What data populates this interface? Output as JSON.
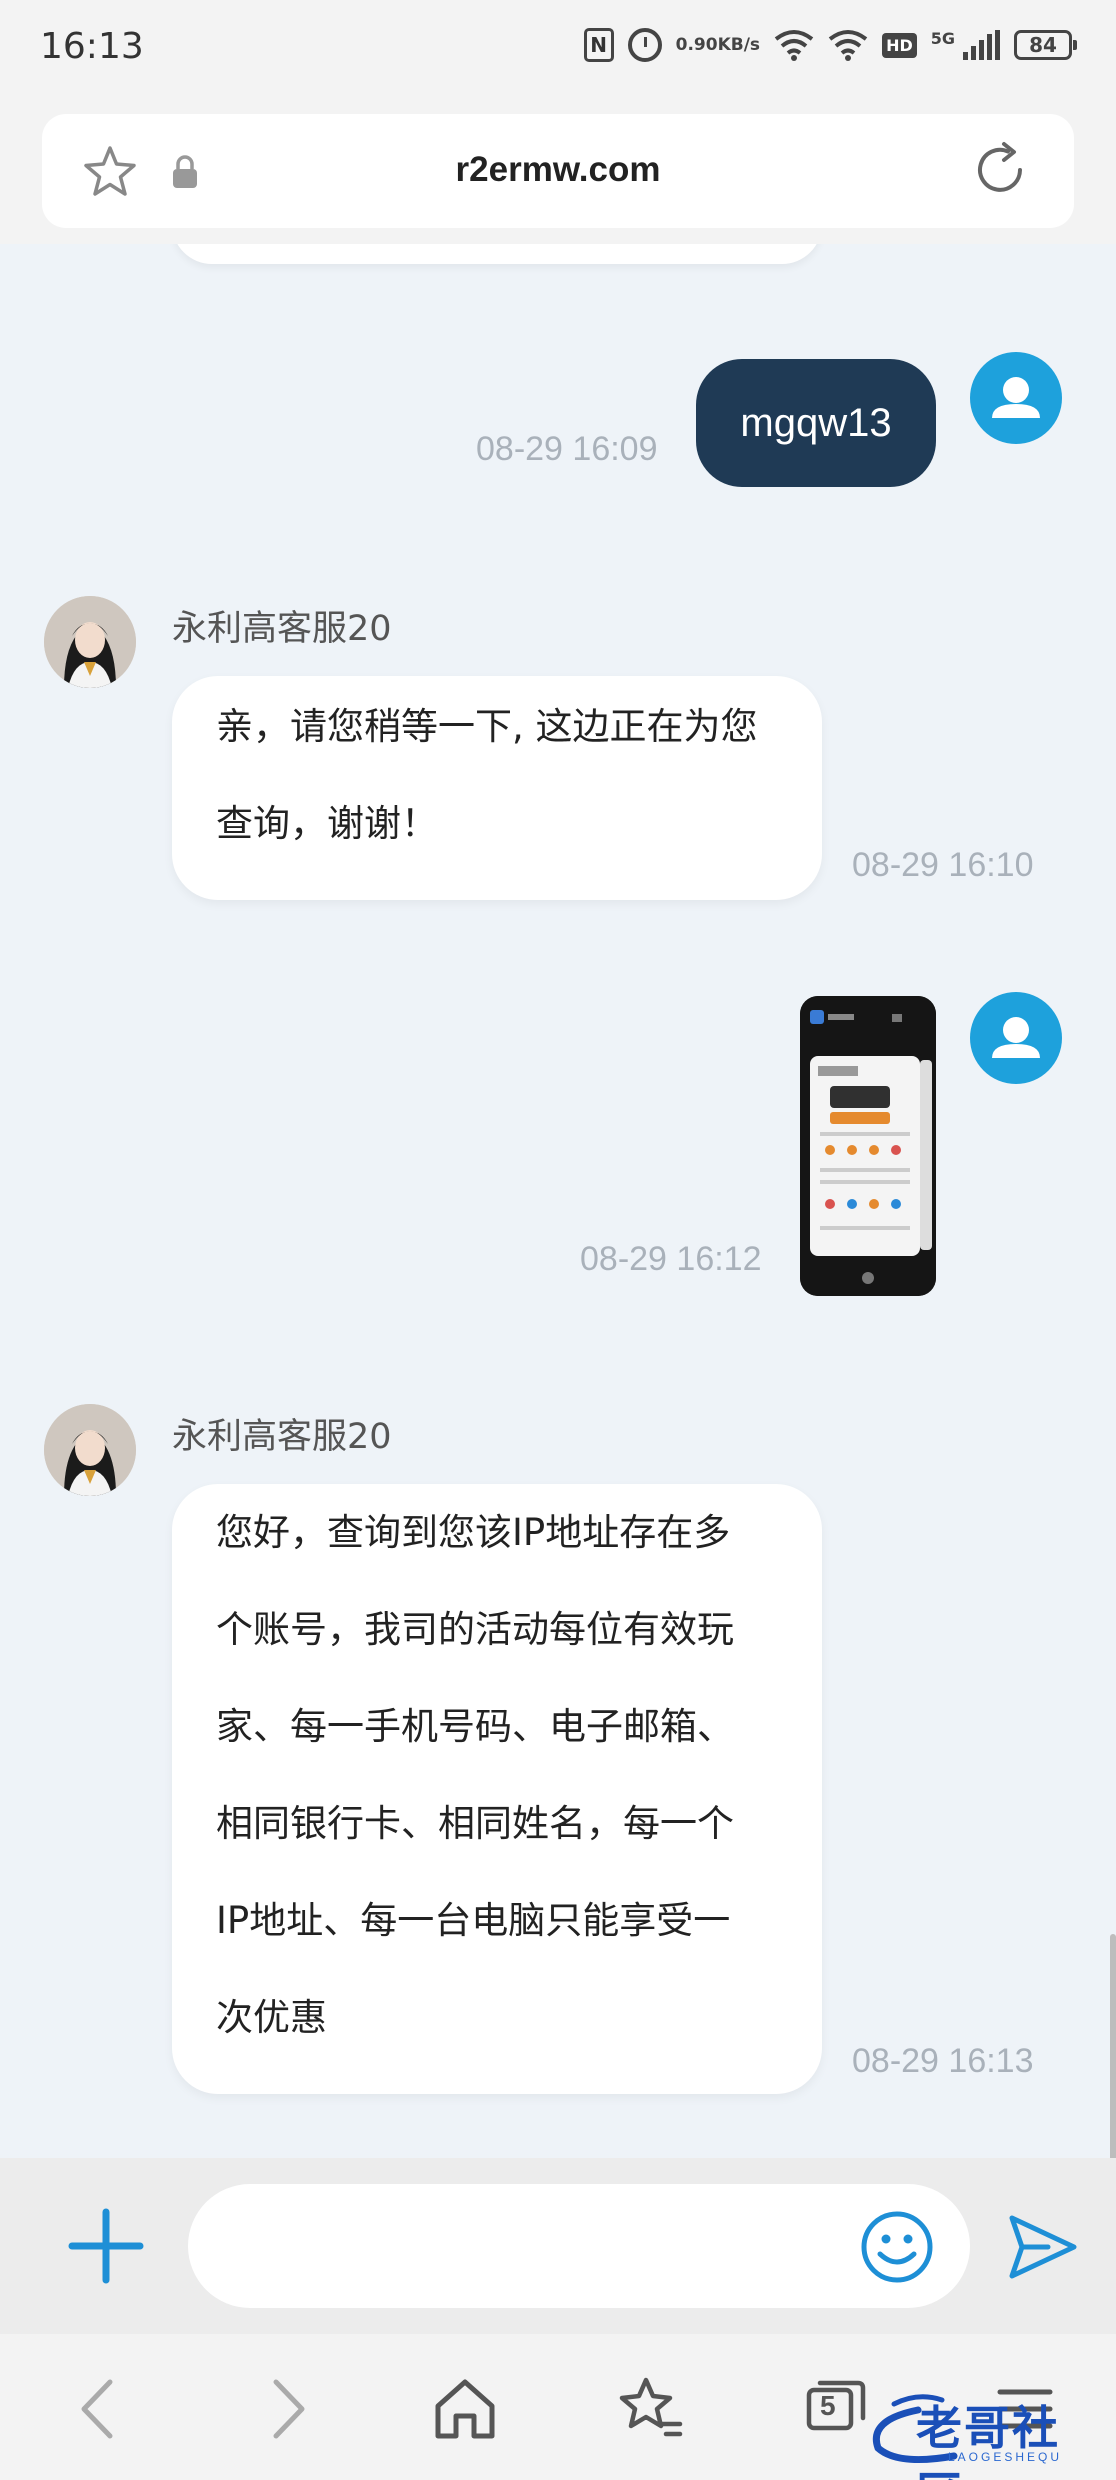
{
  "status_bar": {
    "time": "16:13",
    "net_speed_value": "0.90",
    "net_speed_unit": "KB/s",
    "hd_label": "HD",
    "network_label": "5G",
    "battery": "84"
  },
  "browser": {
    "url": "r2ermw.com"
  },
  "messages": [
    {
      "side": "out",
      "text": "mgqw13",
      "time": "08-29 16:09"
    },
    {
      "side": "in",
      "sender": "永利高客服20",
      "lines": [
        "亲，请您稍等一下, 这边正在为您",
        "查询，谢谢！"
      ],
      "time": "08-29 16:10"
    },
    {
      "side": "out",
      "type": "image",
      "time": "08-29 16:12"
    },
    {
      "side": "in",
      "sender": "永利高客服20",
      "lines": [
        "您好，查询到您该IP地址存在多",
        "个账号，我司的活动每位有效玩",
        "家、每一手机号码、电子邮箱、",
        "相同银行卡、相同姓名，每一个",
        "IP地址、每一台电脑只能享受一",
        "次优惠"
      ],
      "time": "08-29 16:13"
    }
  ],
  "input": {
    "placeholder": ""
  },
  "bottom_nav": {
    "tab_count": "5"
  },
  "watermark": {
    "text": "老哥社区",
    "sub": "LAOGESHEQU"
  },
  "colors": {
    "accent_blue": "#1ea1dc",
    "out_bubble": "#1f3a55",
    "chat_bg": "#eef3f8"
  }
}
